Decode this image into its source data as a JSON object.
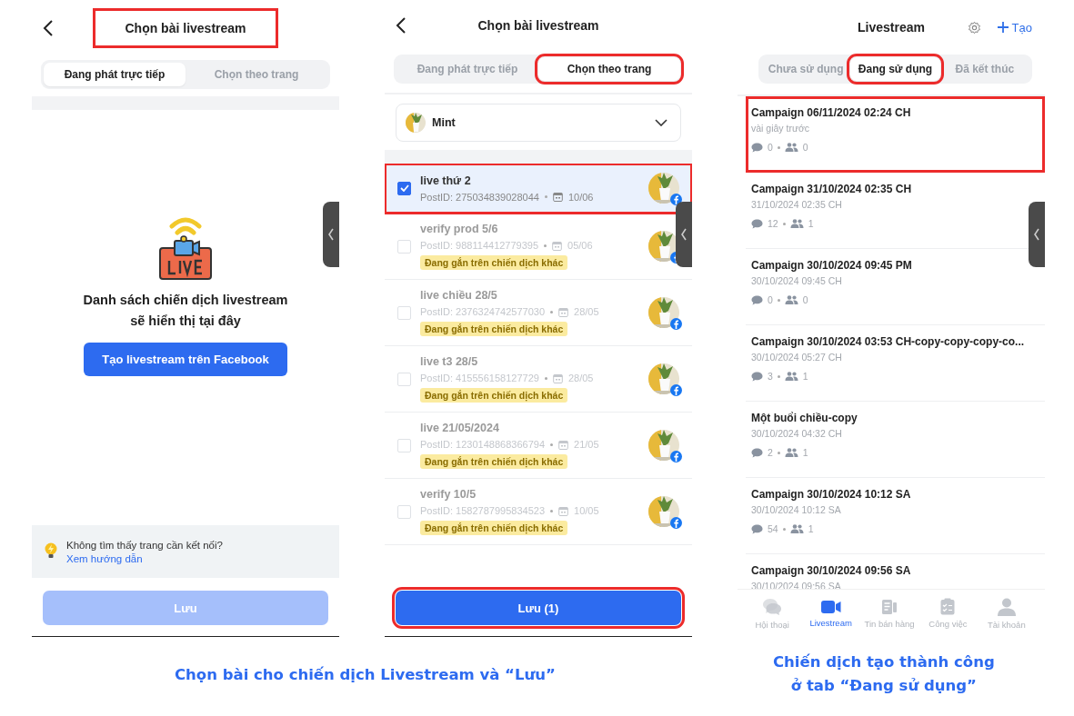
{
  "empty_screen": {
    "title": "Chọn bài livestream",
    "title_highlighted": true,
    "tabs": [
      {
        "label": "Đang phát trực tiếp",
        "selected": true
      },
      {
        "label": "Chọn theo trang",
        "selected": false
      }
    ],
    "empty_message": "Danh sách chiến dịch livestream\nsẽ hiển thị tại đây",
    "create_button": "Tạo livestream trên Facebook",
    "tip": "Không tìm thấy trang cần kết nối?",
    "tip_link": "Xem hướng dẫn",
    "save_button": {
      "label": "Lưu",
      "disabled": true
    }
  },
  "posts_screen": {
    "title": "Chọn bài livestream",
    "tabs": [
      {
        "label": "Đang phát trực tiếp",
        "selected": false,
        "highlighted": false
      },
      {
        "label": "Chọn theo trang",
        "selected": true,
        "highlighted": true
      }
    ],
    "page_picker": {
      "value": "Mint"
    },
    "posts": [
      {
        "title": "live thứ 2",
        "post_id": "PostID: 275034839028044",
        "date": "10/06",
        "checked": true,
        "disabled": false,
        "highlighted": true
      },
      {
        "title": "verify prod 5/6",
        "post_id": "PostID: 988114412779395",
        "date": "05/06",
        "checked": false,
        "disabled": true,
        "highlighted": false,
        "tag": "Đang gắn trên chiến dịch khác"
      },
      {
        "title": "live chiều 28/5",
        "post_id": "PostID: 2376324742577030",
        "date": "28/05",
        "checked": false,
        "disabled": true,
        "highlighted": false,
        "tag": "Đang gắn trên chiến dịch khác"
      },
      {
        "title": "live t3 28/5",
        "post_id": "PostID: 415556158127729",
        "date": "28/05",
        "checked": false,
        "disabled": true,
        "highlighted": false,
        "tag": "Đang gắn trên chiến dịch khác"
      },
      {
        "title": "live 21/05/2024",
        "post_id": "PostID: 1230148868366794",
        "date": "21/05",
        "checked": false,
        "disabled": true,
        "highlighted": false,
        "tag": "Đang gắn trên chiến dịch khác"
      },
      {
        "title": "verify 10/5",
        "post_id": "PostID: 1582787995834523",
        "date": "10/05",
        "checked": false,
        "disabled": true,
        "highlighted": false,
        "tag": "Đang gắn trên chiến dịch khác"
      }
    ],
    "save_button": {
      "label": "Lưu (1)",
      "disabled": false,
      "highlighted": true
    }
  },
  "campaigns_screen": {
    "title": "Livestream",
    "create_button": "Tạo",
    "tabs": [
      {
        "label": "Chưa sử dụng",
        "selected": false,
        "highlighted": false
      },
      {
        "label": "Đang sử dụng",
        "selected": true,
        "highlighted": true
      },
      {
        "label": "Đã kết thúc",
        "selected": false,
        "highlighted": false
      }
    ],
    "campaigns": [
      {
        "title": "Campaign 06/11/2024 02:24 CH",
        "time": "vài giây trước",
        "comments": "0",
        "viewers": "0",
        "highlighted": true
      },
      {
        "title": "Campaign 31/10/2024 02:35 CH",
        "time": "31/10/2024 02:35 CH",
        "comments": "12",
        "viewers": "1",
        "highlighted": false
      },
      {
        "title": "Campaign 30/10/2024 09:45 PM",
        "time": "30/10/2024 09:45 CH",
        "comments": "0",
        "viewers": "0",
        "highlighted": false
      },
      {
        "title": "Campaign 30/10/2024 03:53 CH-copy-copy-copy-co...",
        "time": "30/10/2024 05:27 CH",
        "comments": "3",
        "viewers": "1",
        "highlighted": false
      },
      {
        "title": "Một buổi chiều-copy",
        "time": "30/10/2024 04:32 CH",
        "comments": "2",
        "viewers": "1",
        "highlighted": false
      },
      {
        "title": "Campaign 30/10/2024 10:12 SA",
        "time": "30/10/2024 10:12 SA",
        "comments": "54",
        "viewers": "1",
        "highlighted": false
      },
      {
        "title": "Campaign 30/10/2024 09:56 SA",
        "time": "30/10/2024 09:56 SA",
        "highlighted": false
      }
    ],
    "nav": [
      {
        "label": "Hội thoại",
        "selected": false
      },
      {
        "label": "Livestream",
        "selected": true
      },
      {
        "label": "Tin bán hàng",
        "selected": false
      },
      {
        "label": "Công việc",
        "selected": false
      },
      {
        "label": "Tài khoản",
        "selected": false
      }
    ]
  },
  "captions": {
    "left": "Chọn bài cho chiến dịch Livestream và “Lưu”",
    "right": "Chiến dịch tạo thành công\nở tab “Đang sử dụng”"
  }
}
